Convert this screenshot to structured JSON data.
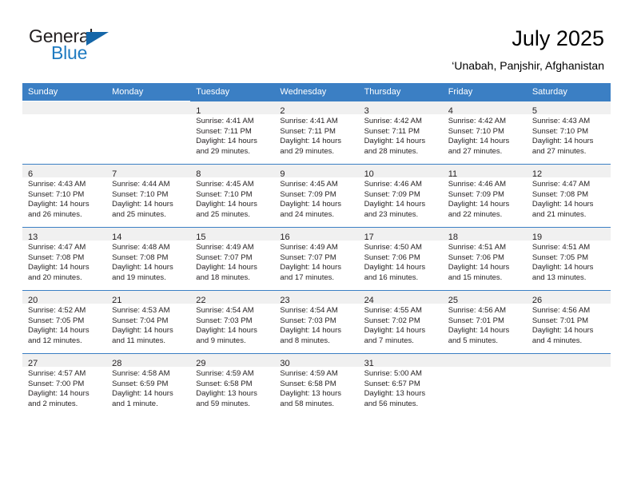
{
  "brand": {
    "name_part1": "General",
    "name_part2": "Blue",
    "logo_icon": "triangle-logo-icon",
    "accent_color": "#1f7bc1"
  },
  "header": {
    "title": "July 2025",
    "subtitle": "‘Unabah, Panjshir, Afghanistan"
  },
  "calendar": {
    "header_bg_color": "#3b7fc4",
    "daynum_band_color": "#f0f0f0",
    "weekday_headers": [
      "Sunday",
      "Monday",
      "Tuesday",
      "Wednesday",
      "Thursday",
      "Friday",
      "Saturday"
    ],
    "weeks": [
      [
        {
          "day": "",
          "sunrise": "",
          "sunset": "",
          "daylight_line1": "",
          "daylight_line2": "",
          "empty": true
        },
        {
          "day": "",
          "sunrise": "",
          "sunset": "",
          "daylight_line1": "",
          "daylight_line2": "",
          "empty": true
        },
        {
          "day": "1",
          "sunrise": "Sunrise: 4:41 AM",
          "sunset": "Sunset: 7:11 PM",
          "daylight_line1": "Daylight: 14 hours",
          "daylight_line2": "and 29 minutes."
        },
        {
          "day": "2",
          "sunrise": "Sunrise: 4:41 AM",
          "sunset": "Sunset: 7:11 PM",
          "daylight_line1": "Daylight: 14 hours",
          "daylight_line2": "and 29 minutes."
        },
        {
          "day": "3",
          "sunrise": "Sunrise: 4:42 AM",
          "sunset": "Sunset: 7:11 PM",
          "daylight_line1": "Daylight: 14 hours",
          "daylight_line2": "and 28 minutes."
        },
        {
          "day": "4",
          "sunrise": "Sunrise: 4:42 AM",
          "sunset": "Sunset: 7:10 PM",
          "daylight_line1": "Daylight: 14 hours",
          "daylight_line2": "and 27 minutes."
        },
        {
          "day": "5",
          "sunrise": "Sunrise: 4:43 AM",
          "sunset": "Sunset: 7:10 PM",
          "daylight_line1": "Daylight: 14 hours",
          "daylight_line2": "and 27 minutes."
        }
      ],
      [
        {
          "day": "6",
          "sunrise": "Sunrise: 4:43 AM",
          "sunset": "Sunset: 7:10 PM",
          "daylight_line1": "Daylight: 14 hours",
          "daylight_line2": "and 26 minutes."
        },
        {
          "day": "7",
          "sunrise": "Sunrise: 4:44 AM",
          "sunset": "Sunset: 7:10 PM",
          "daylight_line1": "Daylight: 14 hours",
          "daylight_line2": "and 25 minutes."
        },
        {
          "day": "8",
          "sunrise": "Sunrise: 4:45 AM",
          "sunset": "Sunset: 7:10 PM",
          "daylight_line1": "Daylight: 14 hours",
          "daylight_line2": "and 25 minutes."
        },
        {
          "day": "9",
          "sunrise": "Sunrise: 4:45 AM",
          "sunset": "Sunset: 7:09 PM",
          "daylight_line1": "Daylight: 14 hours",
          "daylight_line2": "and 24 minutes."
        },
        {
          "day": "10",
          "sunrise": "Sunrise: 4:46 AM",
          "sunset": "Sunset: 7:09 PM",
          "daylight_line1": "Daylight: 14 hours",
          "daylight_line2": "and 23 minutes."
        },
        {
          "day": "11",
          "sunrise": "Sunrise: 4:46 AM",
          "sunset": "Sunset: 7:09 PM",
          "daylight_line1": "Daylight: 14 hours",
          "daylight_line2": "and 22 minutes."
        },
        {
          "day": "12",
          "sunrise": "Sunrise: 4:47 AM",
          "sunset": "Sunset: 7:08 PM",
          "daylight_line1": "Daylight: 14 hours",
          "daylight_line2": "and 21 minutes."
        }
      ],
      [
        {
          "day": "13",
          "sunrise": "Sunrise: 4:47 AM",
          "sunset": "Sunset: 7:08 PM",
          "daylight_line1": "Daylight: 14 hours",
          "daylight_line2": "and 20 minutes."
        },
        {
          "day": "14",
          "sunrise": "Sunrise: 4:48 AM",
          "sunset": "Sunset: 7:08 PM",
          "daylight_line1": "Daylight: 14 hours",
          "daylight_line2": "and 19 minutes."
        },
        {
          "day": "15",
          "sunrise": "Sunrise: 4:49 AM",
          "sunset": "Sunset: 7:07 PM",
          "daylight_line1": "Daylight: 14 hours",
          "daylight_line2": "and 18 minutes."
        },
        {
          "day": "16",
          "sunrise": "Sunrise: 4:49 AM",
          "sunset": "Sunset: 7:07 PM",
          "daylight_line1": "Daylight: 14 hours",
          "daylight_line2": "and 17 minutes."
        },
        {
          "day": "17",
          "sunrise": "Sunrise: 4:50 AM",
          "sunset": "Sunset: 7:06 PM",
          "daylight_line1": "Daylight: 14 hours",
          "daylight_line2": "and 16 minutes."
        },
        {
          "day": "18",
          "sunrise": "Sunrise: 4:51 AM",
          "sunset": "Sunset: 7:06 PM",
          "daylight_line1": "Daylight: 14 hours",
          "daylight_line2": "and 15 minutes."
        },
        {
          "day": "19",
          "sunrise": "Sunrise: 4:51 AM",
          "sunset": "Sunset: 7:05 PM",
          "daylight_line1": "Daylight: 14 hours",
          "daylight_line2": "and 13 minutes."
        }
      ],
      [
        {
          "day": "20",
          "sunrise": "Sunrise: 4:52 AM",
          "sunset": "Sunset: 7:05 PM",
          "daylight_line1": "Daylight: 14 hours",
          "daylight_line2": "and 12 minutes."
        },
        {
          "day": "21",
          "sunrise": "Sunrise: 4:53 AM",
          "sunset": "Sunset: 7:04 PM",
          "daylight_line1": "Daylight: 14 hours",
          "daylight_line2": "and 11 minutes."
        },
        {
          "day": "22",
          "sunrise": "Sunrise: 4:54 AM",
          "sunset": "Sunset: 7:03 PM",
          "daylight_line1": "Daylight: 14 hours",
          "daylight_line2": "and 9 minutes."
        },
        {
          "day": "23",
          "sunrise": "Sunrise: 4:54 AM",
          "sunset": "Sunset: 7:03 PM",
          "daylight_line1": "Daylight: 14 hours",
          "daylight_line2": "and 8 minutes."
        },
        {
          "day": "24",
          "sunrise": "Sunrise: 4:55 AM",
          "sunset": "Sunset: 7:02 PM",
          "daylight_line1": "Daylight: 14 hours",
          "daylight_line2": "and 7 minutes."
        },
        {
          "day": "25",
          "sunrise": "Sunrise: 4:56 AM",
          "sunset": "Sunset: 7:01 PM",
          "daylight_line1": "Daylight: 14 hours",
          "daylight_line2": "and 5 minutes."
        },
        {
          "day": "26",
          "sunrise": "Sunrise: 4:56 AM",
          "sunset": "Sunset: 7:01 PM",
          "daylight_line1": "Daylight: 14 hours",
          "daylight_line2": "and 4 minutes."
        }
      ],
      [
        {
          "day": "27",
          "sunrise": "Sunrise: 4:57 AM",
          "sunset": "Sunset: 7:00 PM",
          "daylight_line1": "Daylight: 14 hours",
          "daylight_line2": "and 2 minutes."
        },
        {
          "day": "28",
          "sunrise": "Sunrise: 4:58 AM",
          "sunset": "Sunset: 6:59 PM",
          "daylight_line1": "Daylight: 14 hours",
          "daylight_line2": "and 1 minute."
        },
        {
          "day": "29",
          "sunrise": "Sunrise: 4:59 AM",
          "sunset": "Sunset: 6:58 PM",
          "daylight_line1": "Daylight: 13 hours",
          "daylight_line2": "and 59 minutes."
        },
        {
          "day": "30",
          "sunrise": "Sunrise: 4:59 AM",
          "sunset": "Sunset: 6:58 PM",
          "daylight_line1": "Daylight: 13 hours",
          "daylight_line2": "and 58 minutes."
        },
        {
          "day": "31",
          "sunrise": "Sunrise: 5:00 AM",
          "sunset": "Sunset: 6:57 PM",
          "daylight_line1": "Daylight: 13 hours",
          "daylight_line2": "and 56 minutes."
        },
        {
          "day": "",
          "sunrise": "",
          "sunset": "",
          "daylight_line1": "",
          "daylight_line2": "",
          "empty": true
        },
        {
          "day": "",
          "sunrise": "",
          "sunset": "",
          "daylight_line1": "",
          "daylight_line2": "",
          "empty": true
        }
      ]
    ]
  }
}
